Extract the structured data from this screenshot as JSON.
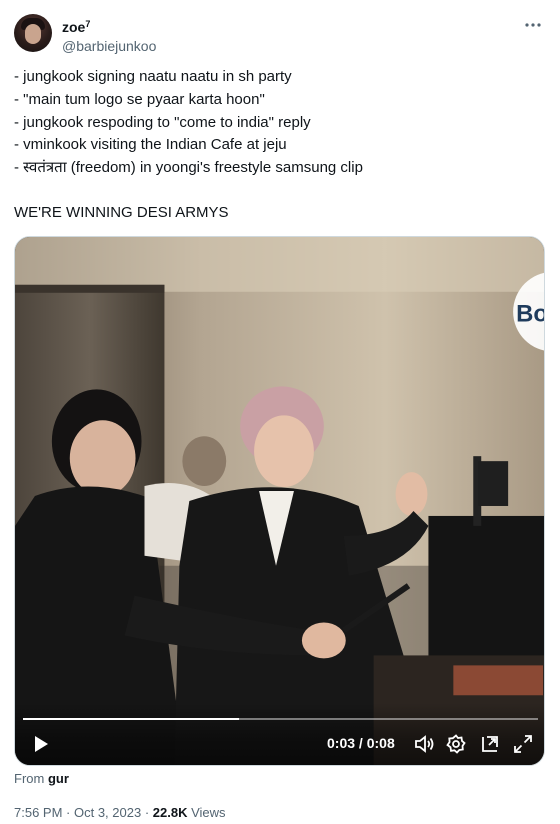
{
  "author": {
    "display_name": "zoe",
    "name_badge": "7",
    "handle": "@barbiejunkoo"
  },
  "tweet": {
    "lines": [
      "- jungkook signing naatu naatu in sh party",
      "- \"main tum logo se pyaar karta hoon\"",
      "- jungkook respoding to \"come to india\" reply",
      "- vminkook visiting the Indian Cafe at jeju",
      "- स्वतंत्रता (freedom) in yoongi's freestyle samsung clip"
    ],
    "closing": "WE'RE WINNING DESI ARMYS"
  },
  "video": {
    "current_time": "0:03",
    "separator": " / ",
    "duration": "0:08",
    "progress_fraction": 0.42,
    "watermark_text": "Bo"
  },
  "source": {
    "prefix": "From ",
    "name": "gur"
  },
  "meta": {
    "time": "7:56 PM",
    "dot": " · ",
    "date": "Oct 3, 2023",
    "views_count": "22.8K",
    "views_label": " Views"
  },
  "icons": {
    "more": "more-icon",
    "play": "play-icon",
    "volume": "volume-icon",
    "settings": "settings-icon",
    "pip": "picture-in-picture-icon",
    "fullscreen": "fullscreen-icon"
  }
}
